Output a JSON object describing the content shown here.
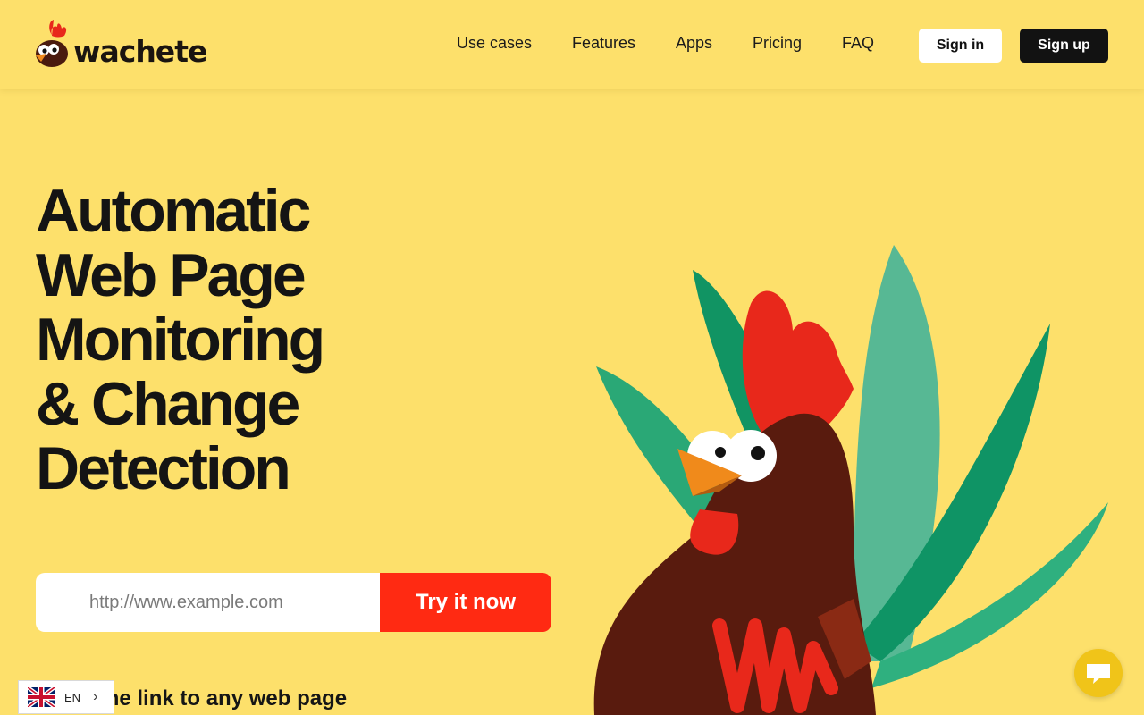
{
  "header": {
    "brand": "wachete",
    "nav": [
      {
        "label": "Use cases"
      },
      {
        "label": "Features"
      },
      {
        "label": "Apps"
      },
      {
        "label": "Pricing"
      },
      {
        "label": "FAQ"
      }
    ],
    "signin_label": "Sign in",
    "signup_label": "Sign up"
  },
  "hero": {
    "title_lines": [
      "Automatic",
      "Web Page",
      "Monitoring",
      "& Change",
      "Detection"
    ],
    "url_placeholder": "http://www.example.com",
    "cta_label": "Try it now",
    "subline": "Paste the link to any web page"
  },
  "language": {
    "code": "EN",
    "flag_icon": "uk-flag-icon"
  },
  "widgets": {
    "chat_icon": "chat-bubble-icon"
  },
  "colors": {
    "background": "#fde06b",
    "cta": "#ff2a12",
    "signup_bg": "#121212",
    "text": "#141414"
  }
}
